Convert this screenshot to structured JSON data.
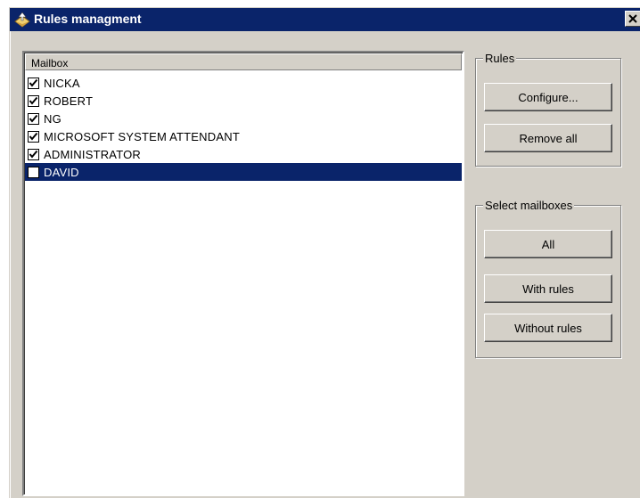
{
  "window": {
    "title": "Rules managment"
  },
  "list": {
    "column_header": "Mailbox",
    "rows": [
      {
        "label": "NICKA",
        "checked": true,
        "selected": false
      },
      {
        "label": "ROBERT",
        "checked": true,
        "selected": false
      },
      {
        "label": "NG",
        "checked": true,
        "selected": false
      },
      {
        "label": "MICROSOFT SYSTEM ATTENDANT",
        "checked": true,
        "selected": false
      },
      {
        "label": "ADMINISTRATOR",
        "checked": true,
        "selected": false
      },
      {
        "label": "DAVID",
        "checked": false,
        "selected": true
      }
    ]
  },
  "rules_group": {
    "label": "Rules",
    "configure_label": "Configure...",
    "remove_all_label": "Remove all"
  },
  "select_group": {
    "label": "Select mailboxes",
    "all_label": "All",
    "with_rules_label": "With rules",
    "without_rules_label": "Without rules"
  },
  "icons": {
    "title": "mail-rules-icon",
    "close": "close-icon",
    "check": "checkmark-icon"
  },
  "colors": {
    "titlebar": "#0a246a",
    "face": "#d4d0c8",
    "selection": "#0a246a"
  }
}
